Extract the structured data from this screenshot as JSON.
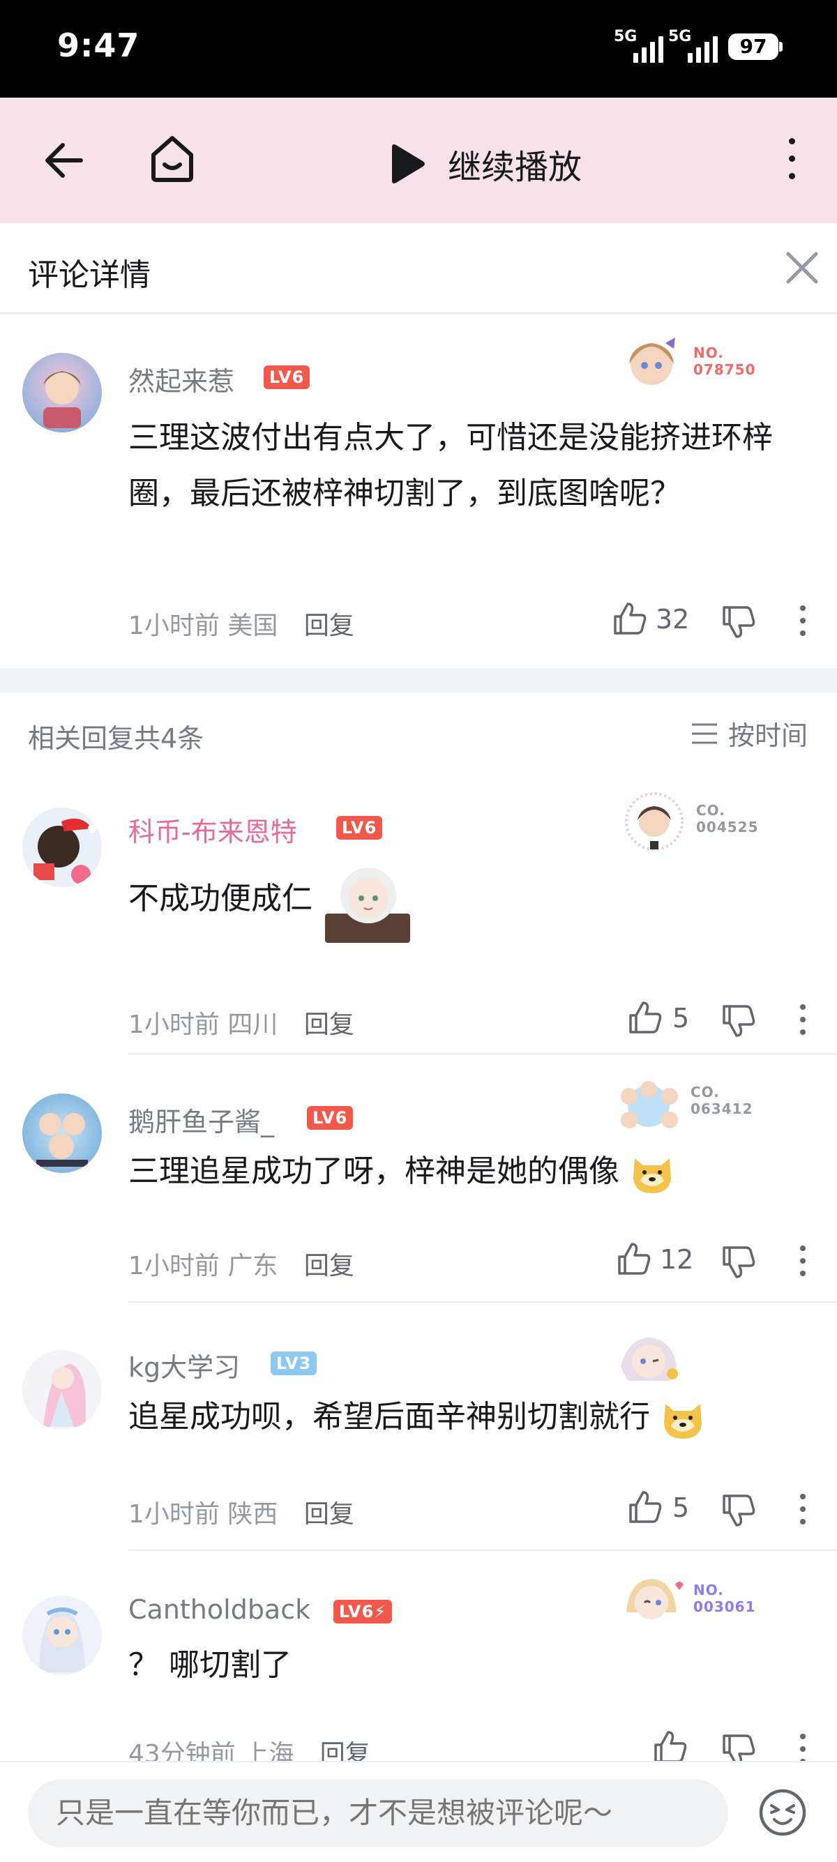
{
  "status_bar": {
    "time": "9:47",
    "network_1": "5G",
    "network_2": "5G",
    "battery": "97"
  },
  "top_nav": {
    "play_label": "继续播放"
  },
  "detail": {
    "title": "评论详情"
  },
  "main_comment": {
    "username": "然起来惹",
    "level": "LV6",
    "badge_no": "NO.\n078750",
    "content": "三理这波付出有点大了，可惜还是没能挤进环梓圈，最后还被梓神切割了，到底图啥呢？",
    "time": "1小时前",
    "location": "美国",
    "reply_label": "回复",
    "likes": "32"
  },
  "replies_header": {
    "count_text": "相关回复共4条",
    "sort_label": "按时间"
  },
  "replies": [
    {
      "username": "科币-布来恩特",
      "level": "LV6",
      "badge_no": "CO.\n004525",
      "content": "不成功便成仁",
      "time": "1小时前",
      "location": "四川",
      "reply_label": "回复",
      "likes": "5"
    },
    {
      "username": "鹅肝鱼子酱_",
      "level": "LV6",
      "badge_no": "CO.\n063412",
      "content": "三理追星成功了呀，梓神是她的偶像",
      "time": "1小时前",
      "location": "广东",
      "reply_label": "回复",
      "likes": "12"
    },
    {
      "username": "kg大学习",
      "level": "LV3",
      "content": "追星成功呗，希望后面辛神别切割就行",
      "time": "1小时前",
      "location": "陕西",
      "reply_label": "回复",
      "likes": "5"
    },
    {
      "username": "Cantholdback",
      "level": "LV6⚡",
      "badge_no": "NO.\n003061",
      "content": "？ 哪切割了",
      "time": "43分钟前",
      "location": "上海",
      "reply_label": "回复"
    }
  ],
  "bottom_bar": {
    "placeholder": "只是一直在等你而已，才不是想被评论呢～"
  },
  "colors": {
    "nav_bg": "#f6e2e8",
    "vip_name": "#e86b95",
    "level_red": "#f2594b",
    "level_blue": "#8cc8f0",
    "badge_red": "#f06a6a",
    "badge_gray": "#9499a0",
    "badge_purple": "#8c7cf0"
  }
}
